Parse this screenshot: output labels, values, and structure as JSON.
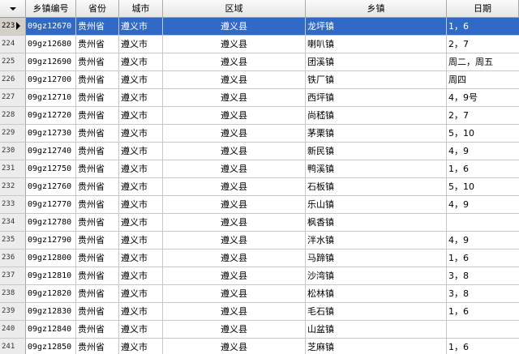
{
  "columns": [
    "乡镇编号",
    "省份",
    "城市",
    "区域",
    "乡镇",
    "日期"
  ],
  "rows": [
    {
      "n": "223",
      "code": "09gz12670",
      "prov": "贵州省",
      "city": "遵义市",
      "area": "遵义县",
      "town": "龙坪镇",
      "date": "1，6"
    },
    {
      "n": "224",
      "code": "09gz12680",
      "prov": "贵州省",
      "city": "遵义市",
      "area": "遵义县",
      "town": "喇叭镇",
      "date": "2，7"
    },
    {
      "n": "225",
      "code": "09gz12690",
      "prov": "贵州省",
      "city": "遵义市",
      "area": "遵义县",
      "town": "团溪镇",
      "date": "周二，周五"
    },
    {
      "n": "226",
      "code": "09gz12700",
      "prov": "贵州省",
      "city": "遵义市",
      "area": "遵义县",
      "town": "铁厂镇",
      "date": "周四"
    },
    {
      "n": "227",
      "code": "09gz12710",
      "prov": "贵州省",
      "city": "遵义市",
      "area": "遵义县",
      "town": "西坪镇",
      "date": "4，9号"
    },
    {
      "n": "228",
      "code": "09gz12720",
      "prov": "贵州省",
      "city": "遵义市",
      "area": "遵义县",
      "town": "尚嵇镇",
      "date": "2，7"
    },
    {
      "n": "229",
      "code": "09gz12730",
      "prov": "贵州省",
      "city": "遵义市",
      "area": "遵义县",
      "town": "茅栗镇",
      "date": "5，10"
    },
    {
      "n": "230",
      "code": "09gz12740",
      "prov": "贵州省",
      "city": "遵义市",
      "area": "遵义县",
      "town": "新民镇",
      "date": "4，9"
    },
    {
      "n": "231",
      "code": "09gz12750",
      "prov": "贵州省",
      "city": "遵义市",
      "area": "遵义县",
      "town": "鸭溪镇",
      "date": "1，6"
    },
    {
      "n": "232",
      "code": "09gz12760",
      "prov": "贵州省",
      "city": "遵义市",
      "area": "遵义县",
      "town": "石板镇",
      "date": "5，10"
    },
    {
      "n": "233",
      "code": "09gz12770",
      "prov": "贵州省",
      "city": "遵义市",
      "area": "遵义县",
      "town": "乐山镇",
      "date": "4，9"
    },
    {
      "n": "234",
      "code": "09gz12780",
      "prov": "贵州省",
      "city": "遵义市",
      "area": "遵义县",
      "town": "枫香镇",
      "date": ""
    },
    {
      "n": "235",
      "code": "09gz12790",
      "prov": "贵州省",
      "city": "遵义市",
      "area": "遵义县",
      "town": "泮水镇",
      "date": "4，9"
    },
    {
      "n": "236",
      "code": "09gz12800",
      "prov": "贵州省",
      "city": "遵义市",
      "area": "遵义县",
      "town": "马蹄镇",
      "date": "1，6"
    },
    {
      "n": "237",
      "code": "09gz12810",
      "prov": "贵州省",
      "city": "遵义市",
      "area": "遵义县",
      "town": "沙湾镇",
      "date": "3，8"
    },
    {
      "n": "238",
      "code": "09gz12820",
      "prov": "贵州省",
      "city": "遵义市",
      "area": "遵义县",
      "town": "松林镇",
      "date": "3，8"
    },
    {
      "n": "239",
      "code": "09gz12830",
      "prov": "贵州省",
      "city": "遵义市",
      "area": "遵义县",
      "town": "毛石镇",
      "date": "1，6"
    },
    {
      "n": "240",
      "code": "09gz12840",
      "prov": "贵州省",
      "city": "遵义市",
      "area": "遵义县",
      "town": "山盆镇",
      "date": ""
    },
    {
      "n": "241",
      "code": "09gz12850",
      "prov": "贵州省",
      "city": "遵义市",
      "area": "遵义县",
      "town": "芝麻镇",
      "date": "1，6"
    }
  ],
  "selected_row": "223",
  "colors": {
    "selection": "#3169c6",
    "grid": "#c8c8c8",
    "header": "#e6e6e6"
  }
}
